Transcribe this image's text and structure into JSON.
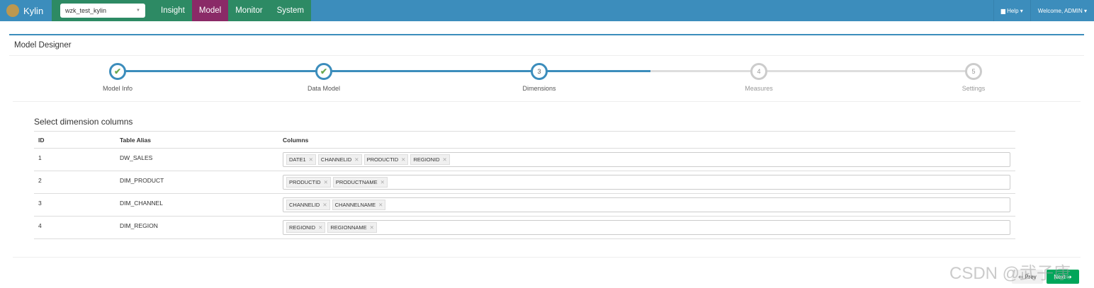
{
  "nav": {
    "brand": "Kylin",
    "project": "wzk_test_kylin",
    "menus": [
      "Insight",
      "Model",
      "Monitor",
      "System"
    ],
    "active": "Model",
    "help": "Help",
    "welcome": "Welcome, ADMIN"
  },
  "colors": {
    "nav": "#3c8dbc",
    "nav_menu": "#2d8a64",
    "active_menu": "#8a2a67",
    "next_button": "#00a65a"
  },
  "panel": {
    "title": "Model Designer"
  },
  "steps": [
    {
      "num": "✔",
      "label": "Model Info",
      "state": "done"
    },
    {
      "num": "✔",
      "label": "Data Model",
      "state": "done"
    },
    {
      "num": "3",
      "label": "Dimensions",
      "state": "current"
    },
    {
      "num": "4",
      "label": "Measures",
      "state": "todo"
    },
    {
      "num": "5",
      "label": "Settings",
      "state": "todo"
    }
  ],
  "section": {
    "title": "Select dimension columns",
    "headers": [
      "ID",
      "Table Alias",
      "Columns"
    ],
    "rows": [
      {
        "id": "1",
        "alias": "DW_SALES",
        "columns": [
          "DATE1",
          "CHANNELID",
          "PRODUCTID",
          "REGIONID"
        ]
      },
      {
        "id": "2",
        "alias": "DIM_PRODUCT",
        "columns": [
          "PRODUCTID",
          "PRODUCTNAME"
        ]
      },
      {
        "id": "3",
        "alias": "DIM_CHANNEL",
        "columns": [
          "CHANNELID",
          "CHANNELNAME"
        ]
      },
      {
        "id": "4",
        "alias": "DIM_REGION",
        "columns": [
          "REGIONID",
          "REGIONNAME"
        ]
      }
    ]
  },
  "buttons": {
    "prev": "Prev",
    "next": "Next"
  },
  "watermark": "CSDN @武子康"
}
